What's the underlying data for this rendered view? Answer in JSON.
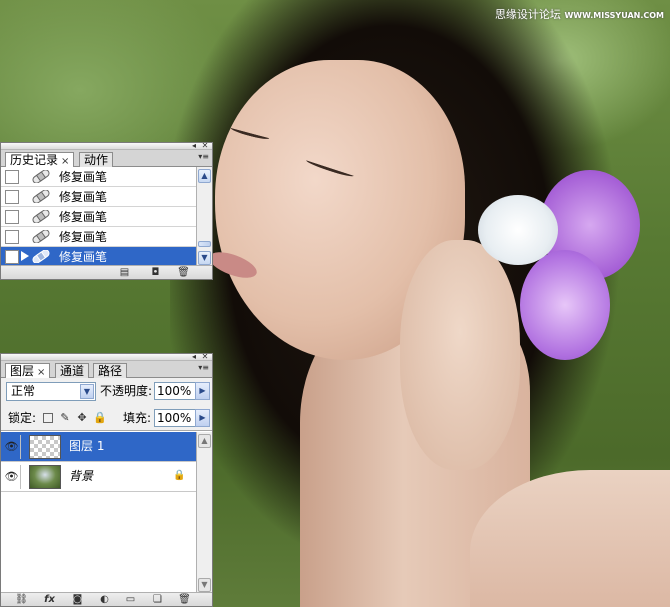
{
  "watermark": {
    "cn": "思缘设计论坛",
    "en": "WWW.MISSYUAN.COM"
  },
  "history_panel": {
    "tabs": [
      {
        "label": "历史记录",
        "active": true,
        "closable": true
      },
      {
        "label": "动作",
        "active": false
      }
    ],
    "close_glyph": "×",
    "items": [
      {
        "label": "修复画笔",
        "selected": false
      },
      {
        "label": "修复画笔",
        "selected": false
      },
      {
        "label": "修复画笔",
        "selected": false
      },
      {
        "label": "修复画笔",
        "selected": false
      },
      {
        "label": "修复画笔",
        "selected": true
      }
    ],
    "bottom_icons": [
      "new-document-from-state-icon",
      "new-snapshot-icon",
      "delete-state-icon"
    ]
  },
  "layers_panel": {
    "tabs": [
      {
        "label": "图层",
        "active": true,
        "closable": true
      },
      {
        "label": "通道",
        "active": false
      },
      {
        "label": "路径",
        "active": false
      }
    ],
    "close_glyph": "×",
    "blend_mode": "正常",
    "opacity_label": "不透明度:",
    "opacity_value": "100%",
    "lock_label": "锁定:",
    "fill_label": "填充:",
    "fill_value": "100%",
    "layers": [
      {
        "name": "图层 1",
        "selected": true,
        "visible": true,
        "thumbnail": "transparent",
        "locked": false
      },
      {
        "name": "背景",
        "selected": false,
        "visible": true,
        "thumbnail": "photo",
        "locked": true
      }
    ],
    "bottom_icons": [
      "link-layers-icon",
      "layer-style-fx-icon",
      "add-mask-icon",
      "adjustment-layer-icon",
      "new-group-icon",
      "new-layer-icon",
      "delete-layer-icon"
    ]
  },
  "colors": {
    "selection": "#2f67c7",
    "panel_border": "#7a7a7a"
  }
}
